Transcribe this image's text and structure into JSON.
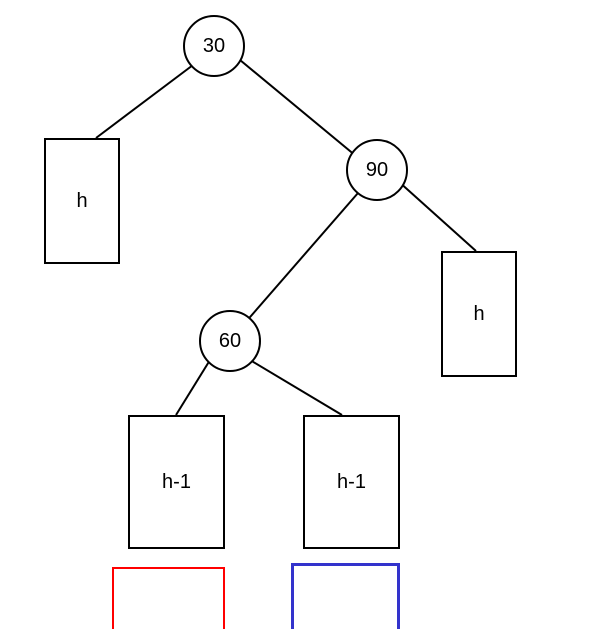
{
  "nodes": {
    "root": "30",
    "right": "90",
    "right_left": "60"
  },
  "subtrees": {
    "left": "h",
    "right_right": "h",
    "rl_left": "h-1",
    "rl_right": "h-1"
  },
  "colors": {
    "ghost_left_border": "#ff0000",
    "ghost_right_border": "#3333cc"
  }
}
